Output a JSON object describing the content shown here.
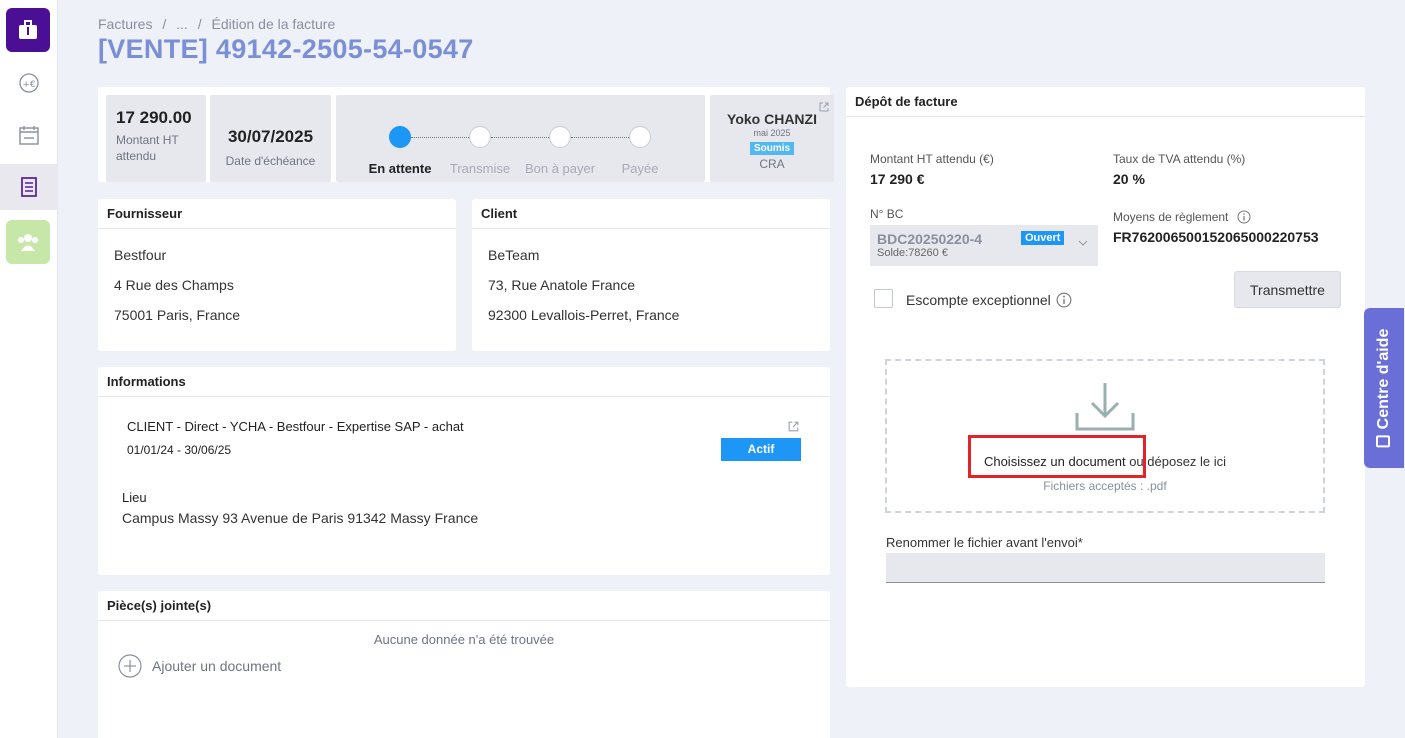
{
  "breadcrumb": {
    "root": "Factures",
    "sep1": "/",
    "ellipsis": "...",
    "sep2": "/",
    "current": "Édition de la facture"
  },
  "page_title": "[VENTE] 49142-2505-54-0547",
  "summary": {
    "amount_value": "17 290.00",
    "amount_label": "Montant HT attendu",
    "due_value": "30/07/2025",
    "due_label": "Date d'échéance",
    "steps": [
      {
        "label": "En attente",
        "active": true
      },
      {
        "label": "Transmise",
        "active": false
      },
      {
        "label": "Bon à payer",
        "active": false
      },
      {
        "label": "Payée",
        "active": false
      }
    ],
    "cra": {
      "name": "Yoko CHANZI",
      "month": "mai 2025",
      "status": "Soumis",
      "label": "CRA"
    }
  },
  "fournisseur": {
    "title": "Fournisseur",
    "lines": [
      "Bestfour",
      "4 Rue des Champs",
      "75001 Paris, France"
    ]
  },
  "client": {
    "title": "Client",
    "lines": [
      "BeTeam",
      "73, Rue Anatole France",
      "92300 Levallois-Perret, France"
    ]
  },
  "informations": {
    "title": "Informations",
    "mission": "CLIENT - Direct - YCHA - Bestfour - Expertise SAP - achat",
    "dates": "01/01/24 - 30/06/25",
    "status": "Actif",
    "lieu_label": "Lieu",
    "lieu_value": "Campus Massy 93 Avenue de Paris 91342 Massy France"
  },
  "attachments": {
    "title": "Pièce(s) jointe(s)",
    "empty": "Aucune donnée n'a été trouvée",
    "add_label": "Ajouter un document"
  },
  "depot": {
    "title": "Dépôt de facture",
    "amount_label": "Montant HT attendu (€)",
    "amount_value": "17 290 €",
    "vat_label": "Taux de TVA attendu (%)",
    "vat_value": "20 %",
    "bc_label": "N° BC",
    "bc_code": "BDC20250220-4",
    "bc_status": "Ouvert",
    "bc_solde": "Solde:78260 €",
    "payment_label": "Moyens de règlement",
    "payment_value": "FR7620065001520650002207‌53",
    "transmit_label": "Transmettre",
    "escompte_label": "Escompte exceptionnel",
    "drop_choose": "Choisissez un document",
    "drop_rest": " ou déposez le ici",
    "drop_accepted": "Fichiers acceptés : .pdf",
    "rename_label": "Renommer le fichier avant l'envoi*",
    "rename_value": ""
  },
  "help_tab": {
    "label": "Centre d'aide"
  },
  "colors": {
    "accent": "#7a8fd6",
    "brand": "#4b0f96",
    "active_step": "#1e96f5",
    "highlight": "#e3222a",
    "help": "#6a6fd8"
  }
}
